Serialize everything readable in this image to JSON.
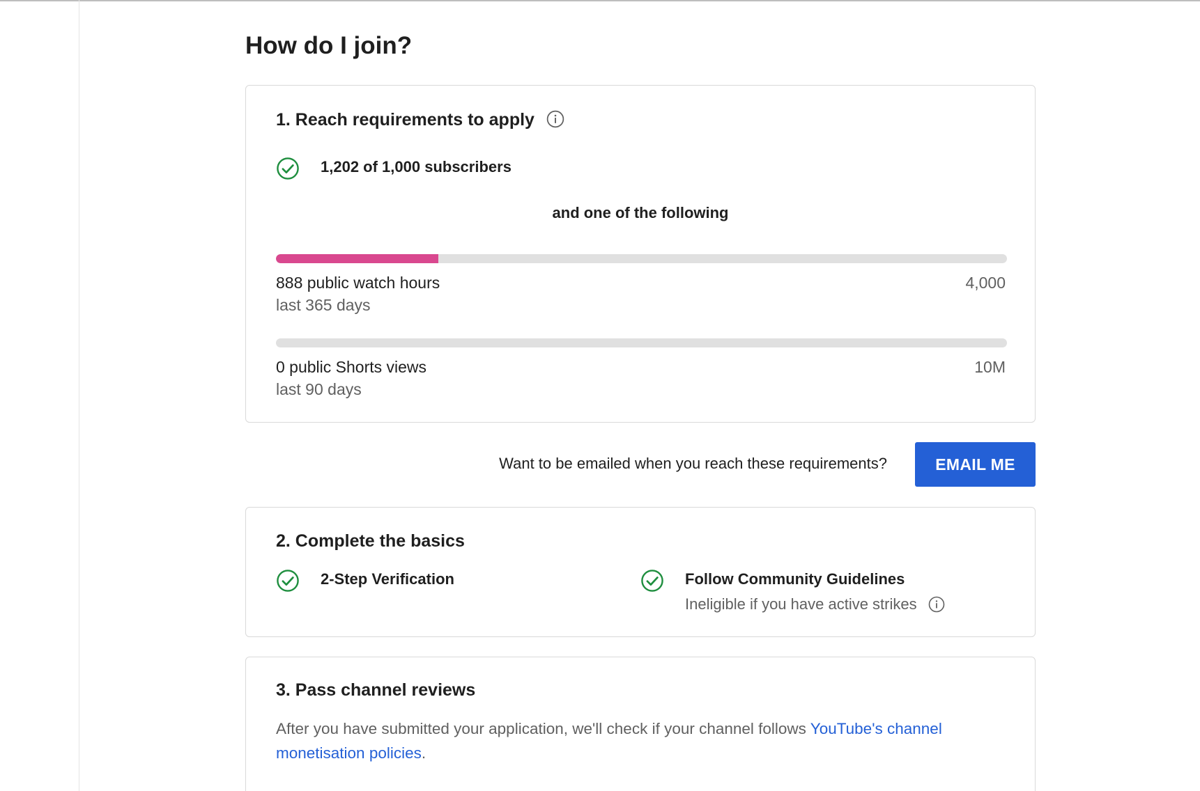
{
  "page_title": "How do I join?",
  "colors": {
    "accent_blue": "#2460d6",
    "progress_pink": "#d9488f",
    "check_green": "#1e8e3e",
    "track_grey": "#e0e0e0"
  },
  "step1": {
    "title": "1. Reach requirements to apply",
    "info_icon": "info-icon",
    "subscribers": {
      "icon": "check-circle-icon",
      "label": "1,202 of 1,000 subscribers"
    },
    "divider_text": "and one of the following",
    "watch_hours": {
      "progress_fraction": 0.222,
      "label": "888 public watch hours",
      "period": "last 365 days",
      "target": "4,000"
    },
    "shorts_views": {
      "progress_fraction": 0,
      "label": "0 public Shorts views",
      "period": "last 90 days",
      "target": "10M"
    }
  },
  "email": {
    "prompt": "Want to be emailed when you reach these requirements?",
    "button_label": "EMAIL ME"
  },
  "step2": {
    "title": "2. Complete the basics",
    "verification": {
      "icon": "check-circle-icon",
      "label": "2-Step Verification"
    },
    "guidelines": {
      "icon": "check-circle-icon",
      "label": "Follow Community Guidelines",
      "sub": "Ineligible if you have active strikes",
      "info_icon": "info-icon"
    }
  },
  "step3": {
    "title": "3. Pass channel reviews",
    "text": "After you have submitted your application, we'll check if your channel follows ",
    "link_text": "YouTube's channel monetisation policies",
    "text_end": "."
  }
}
